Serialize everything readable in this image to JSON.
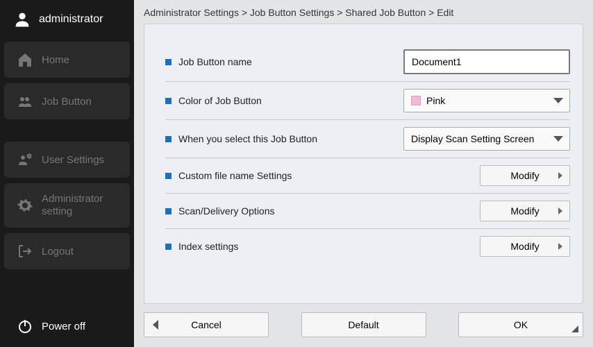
{
  "sidebar": {
    "user_label": "administrator",
    "items": [
      {
        "label": "Home"
      },
      {
        "label": "Job Button"
      },
      {
        "label": "User Settings"
      },
      {
        "label": "Administrator setting"
      },
      {
        "label": "Logout"
      }
    ],
    "power_off": "Power off"
  },
  "breadcrumb": "Administrator Settings > Job Button Settings > Shared Job Button > Edit",
  "form": {
    "job_button_name": {
      "label": "Job Button name",
      "value": "Document1"
    },
    "color": {
      "label": "Color of Job Button",
      "value": "Pink",
      "swatch": "#f2b9d6"
    },
    "on_select": {
      "label": "When you select this Job Button",
      "value": "Display Scan Setting Screen"
    },
    "custom_file": {
      "label": "Custom file name Settings",
      "action": "Modify"
    },
    "scan_delivery": {
      "label": "Scan/Delivery Options",
      "action": "Modify"
    },
    "index": {
      "label": "Index settings",
      "action": "Modify"
    }
  },
  "footer": {
    "cancel": "Cancel",
    "default": "Default",
    "ok": "OK"
  }
}
